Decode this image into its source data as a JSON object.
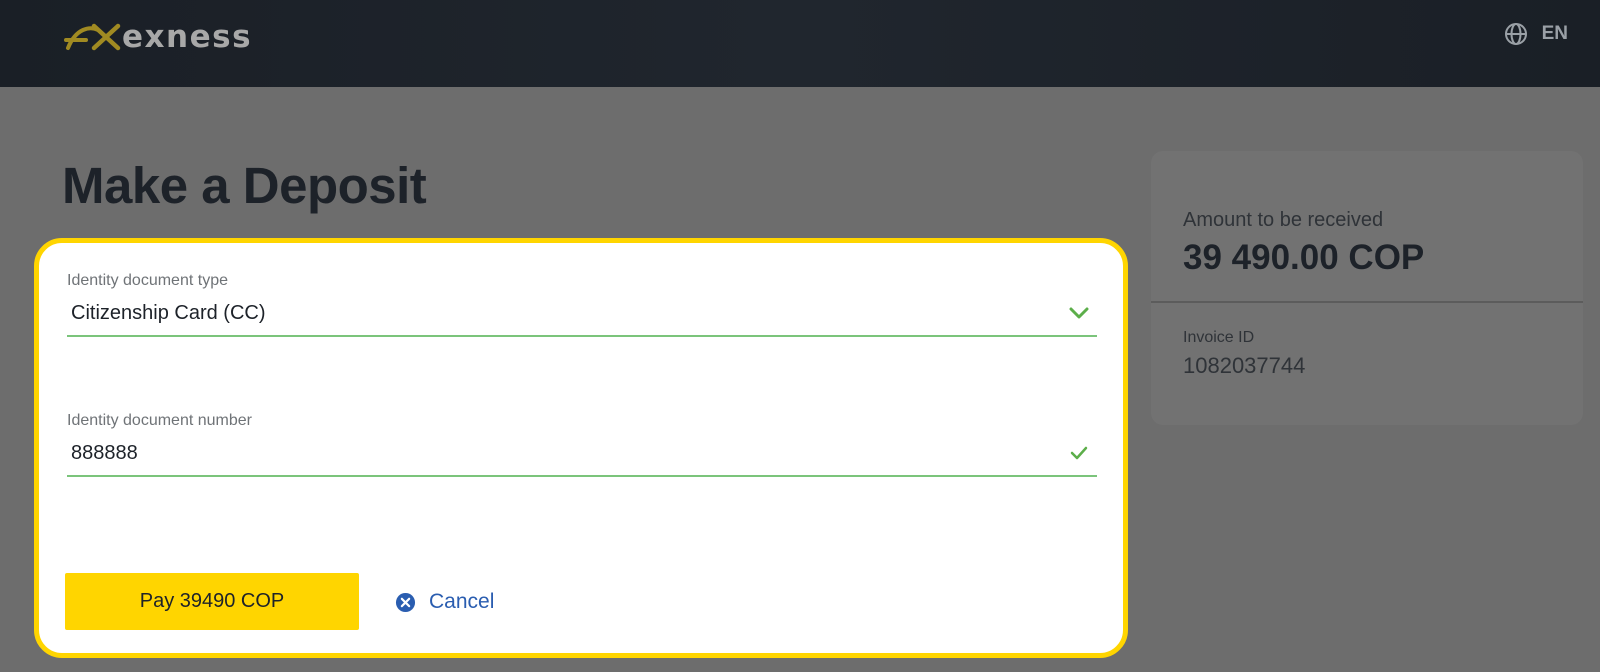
{
  "brand": {
    "name": "exness",
    "accent_color": "#ffd500"
  },
  "header": {
    "language_label": "EN",
    "language_icon": "globe-icon"
  },
  "page": {
    "title": "Make a Deposit"
  },
  "form": {
    "document_type": {
      "label": "Identity document type",
      "value": "Citizenship Card (CC)",
      "icon": "chevron-down-icon",
      "valid": true
    },
    "document_number": {
      "label": "Identity document number",
      "value": "888888",
      "icon": "checkmark-icon",
      "valid": true
    },
    "valid_color": "#7bc47b",
    "pay_label": "Pay 39490 COP",
    "cancel_label": "Cancel",
    "cancel_icon": "close-circle-icon"
  },
  "summary": {
    "amount_label": "Amount to be received",
    "amount_value": "39 490.00 COP",
    "invoice_label": "Invoice ID",
    "invoice_value": "1082037744"
  }
}
